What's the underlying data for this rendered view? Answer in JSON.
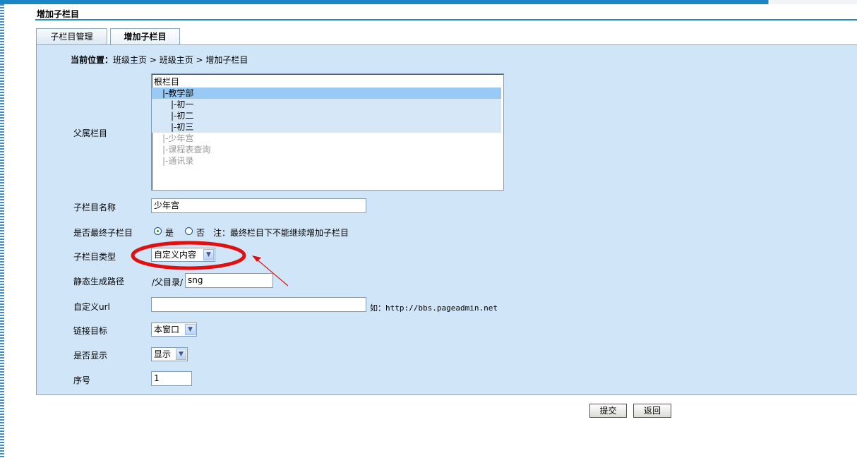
{
  "page": {
    "title": "增加子栏目"
  },
  "tabs": [
    {
      "label": "子栏目管理"
    },
    {
      "label": "增加子栏目"
    }
  ],
  "breadcrumb": {
    "prefix": "当前位置：",
    "path": "班级主页 > 班级主页 > 增加子栏目"
  },
  "form": {
    "parent": {
      "label": "父属栏目",
      "items": [
        "根栏目",
        "|-教学部",
        "|-初一",
        "|-初二",
        "|-初三",
        "|-少年宫",
        "|-课程表查询",
        "|-通讯录"
      ]
    },
    "name": {
      "label": "子栏目名称",
      "value": "少年宫"
    },
    "final": {
      "label": "是否最终子栏目",
      "opt_yes": "是",
      "opt_no": "否",
      "selected": "是",
      "note": "注：最终栏目下不能继续增加子栏目"
    },
    "type": {
      "label": "子栏目类型",
      "value": "自定义内容"
    },
    "static_path": {
      "label": "静态生成路径",
      "prefix": "/父目录/",
      "value": "sng"
    },
    "custom_url": {
      "label": "自定义url",
      "value": "",
      "hint": "如：http://bbs.pageadmin.net"
    },
    "target": {
      "label": "链接目标",
      "value": "本窗口"
    },
    "visible": {
      "label": "是否显示",
      "value": "显示"
    },
    "order": {
      "label": "序号",
      "value": "1"
    }
  },
  "buttons": {
    "submit": "提交",
    "back": "返回"
  },
  "annotation": {
    "color": "#e01010"
  }
}
